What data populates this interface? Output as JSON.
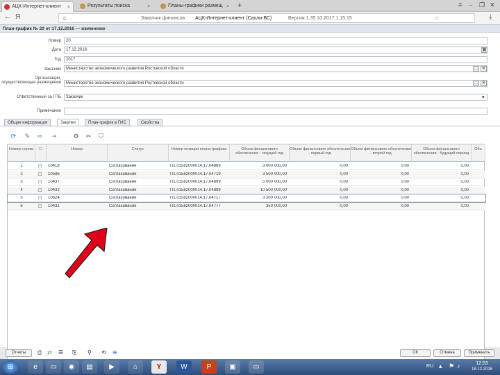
{
  "browser": {
    "tabs": [
      {
        "label": "АЦК-Интернет-клиент"
      },
      {
        "label": "Результаты поиска"
      },
      {
        "label": "Планы-графики размещ"
      }
    ],
    "new_tab": "+",
    "address_prefix": "Заказчик финансов",
    "address_main": "АЦК-Интернет-клиент (Сахли-ВС)",
    "address_version": "Версия 1.35.10.2017.1.15.15",
    "nav_back": "←",
    "nav_fwd": "Я",
    "reload": "c"
  },
  "document": {
    "title": "План-график № 20 от 17.12.2016 — изменение",
    "fields": {
      "number_label": "Номер",
      "number_value": "20",
      "date_label": "Дата",
      "date_value": "17.12.2016",
      "year_label": "Год",
      "year_value": "2017",
      "customer_label": "Заказчик",
      "customer_value": "Министерство экономического развития Ростовской области",
      "org_label": "Организация, осуществляющая размещение",
      "org_value": "Министерство экономического развития Ростовской области",
      "responsible_label": "Ответственный за ГПБ",
      "responsible_value": "Заказчик",
      "note_label": "Примечание"
    },
    "tabs": [
      "Общая информация",
      "Закупки",
      "План-график в ГИС",
      "Свойства"
    ],
    "active_tab_index": 1,
    "grid": {
      "columns": [
        "Номер строки",
        "",
        "Номер",
        "Статус",
        "Номер позиции плана-графика",
        "Объем финансового обеспечения - текущий год",
        "Объем финансового обеспечения - первый год",
        "Объем финансового обеспечения - второй год",
        "Объем финансового обеспечения - будущий период",
        "Объ"
      ],
      "rows": [
        {
          "n": "1",
          "num": "10418",
          "status": "Согласование",
          "pos": "П1.01582000014.17.04889",
          "cur": "3 000 000,00",
          "y1": "0,00",
          "y2": "0,00",
          "fut": "0,00"
        },
        {
          "n": "2",
          "num": "10586",
          "status": "Согласование",
          "pos": "П1.01582000014.17.04719",
          "cur": "3 500 000,00",
          "y1": "0,00",
          "y2": "0,00",
          "fut": "0,00"
        },
        {
          "n": "3",
          "num": "10437",
          "status": "Согласование",
          "pos": "П1.01582000014.17.04899",
          "cur": "5 000 000,00",
          "y1": "0,00",
          "y2": "0,00",
          "fut": "0,00"
        },
        {
          "n": "4",
          "num": "10432",
          "status": "Согласование",
          "pos": "П1.01582000014.17.04899",
          "cur": "10 500 000,00",
          "y1": "0,00",
          "y2": "0,00",
          "fut": "0,00"
        },
        {
          "n": "5",
          "num": "10624",
          "status": "Согласование",
          "pos": "П1.01582000014.17.04717",
          "cur": "3 200 000,00",
          "y1": "0,00",
          "y2": "0,00",
          "fut": "0,00"
        },
        {
          "n": "6",
          "num": "10431",
          "status": "Согласование",
          "pos": "П1.01582000014.17.04777",
          "cur": "350 000,00",
          "y1": "0,00",
          "y2": "0,00",
          "fut": "0,00"
        }
      ]
    },
    "footer": {
      "export_label": "Отчеты",
      "ok_label": "ОК",
      "cancel_label": "Отмена",
      "apply_label": "Применить"
    }
  },
  "taskbar": {
    "time": "12:53",
    "date": "18.12.2016",
    "lang": "RU"
  },
  "colors": {
    "arrow": "#e0001b",
    "selection_outline": "#8899aa",
    "taskbar": "#3a5f8f"
  }
}
